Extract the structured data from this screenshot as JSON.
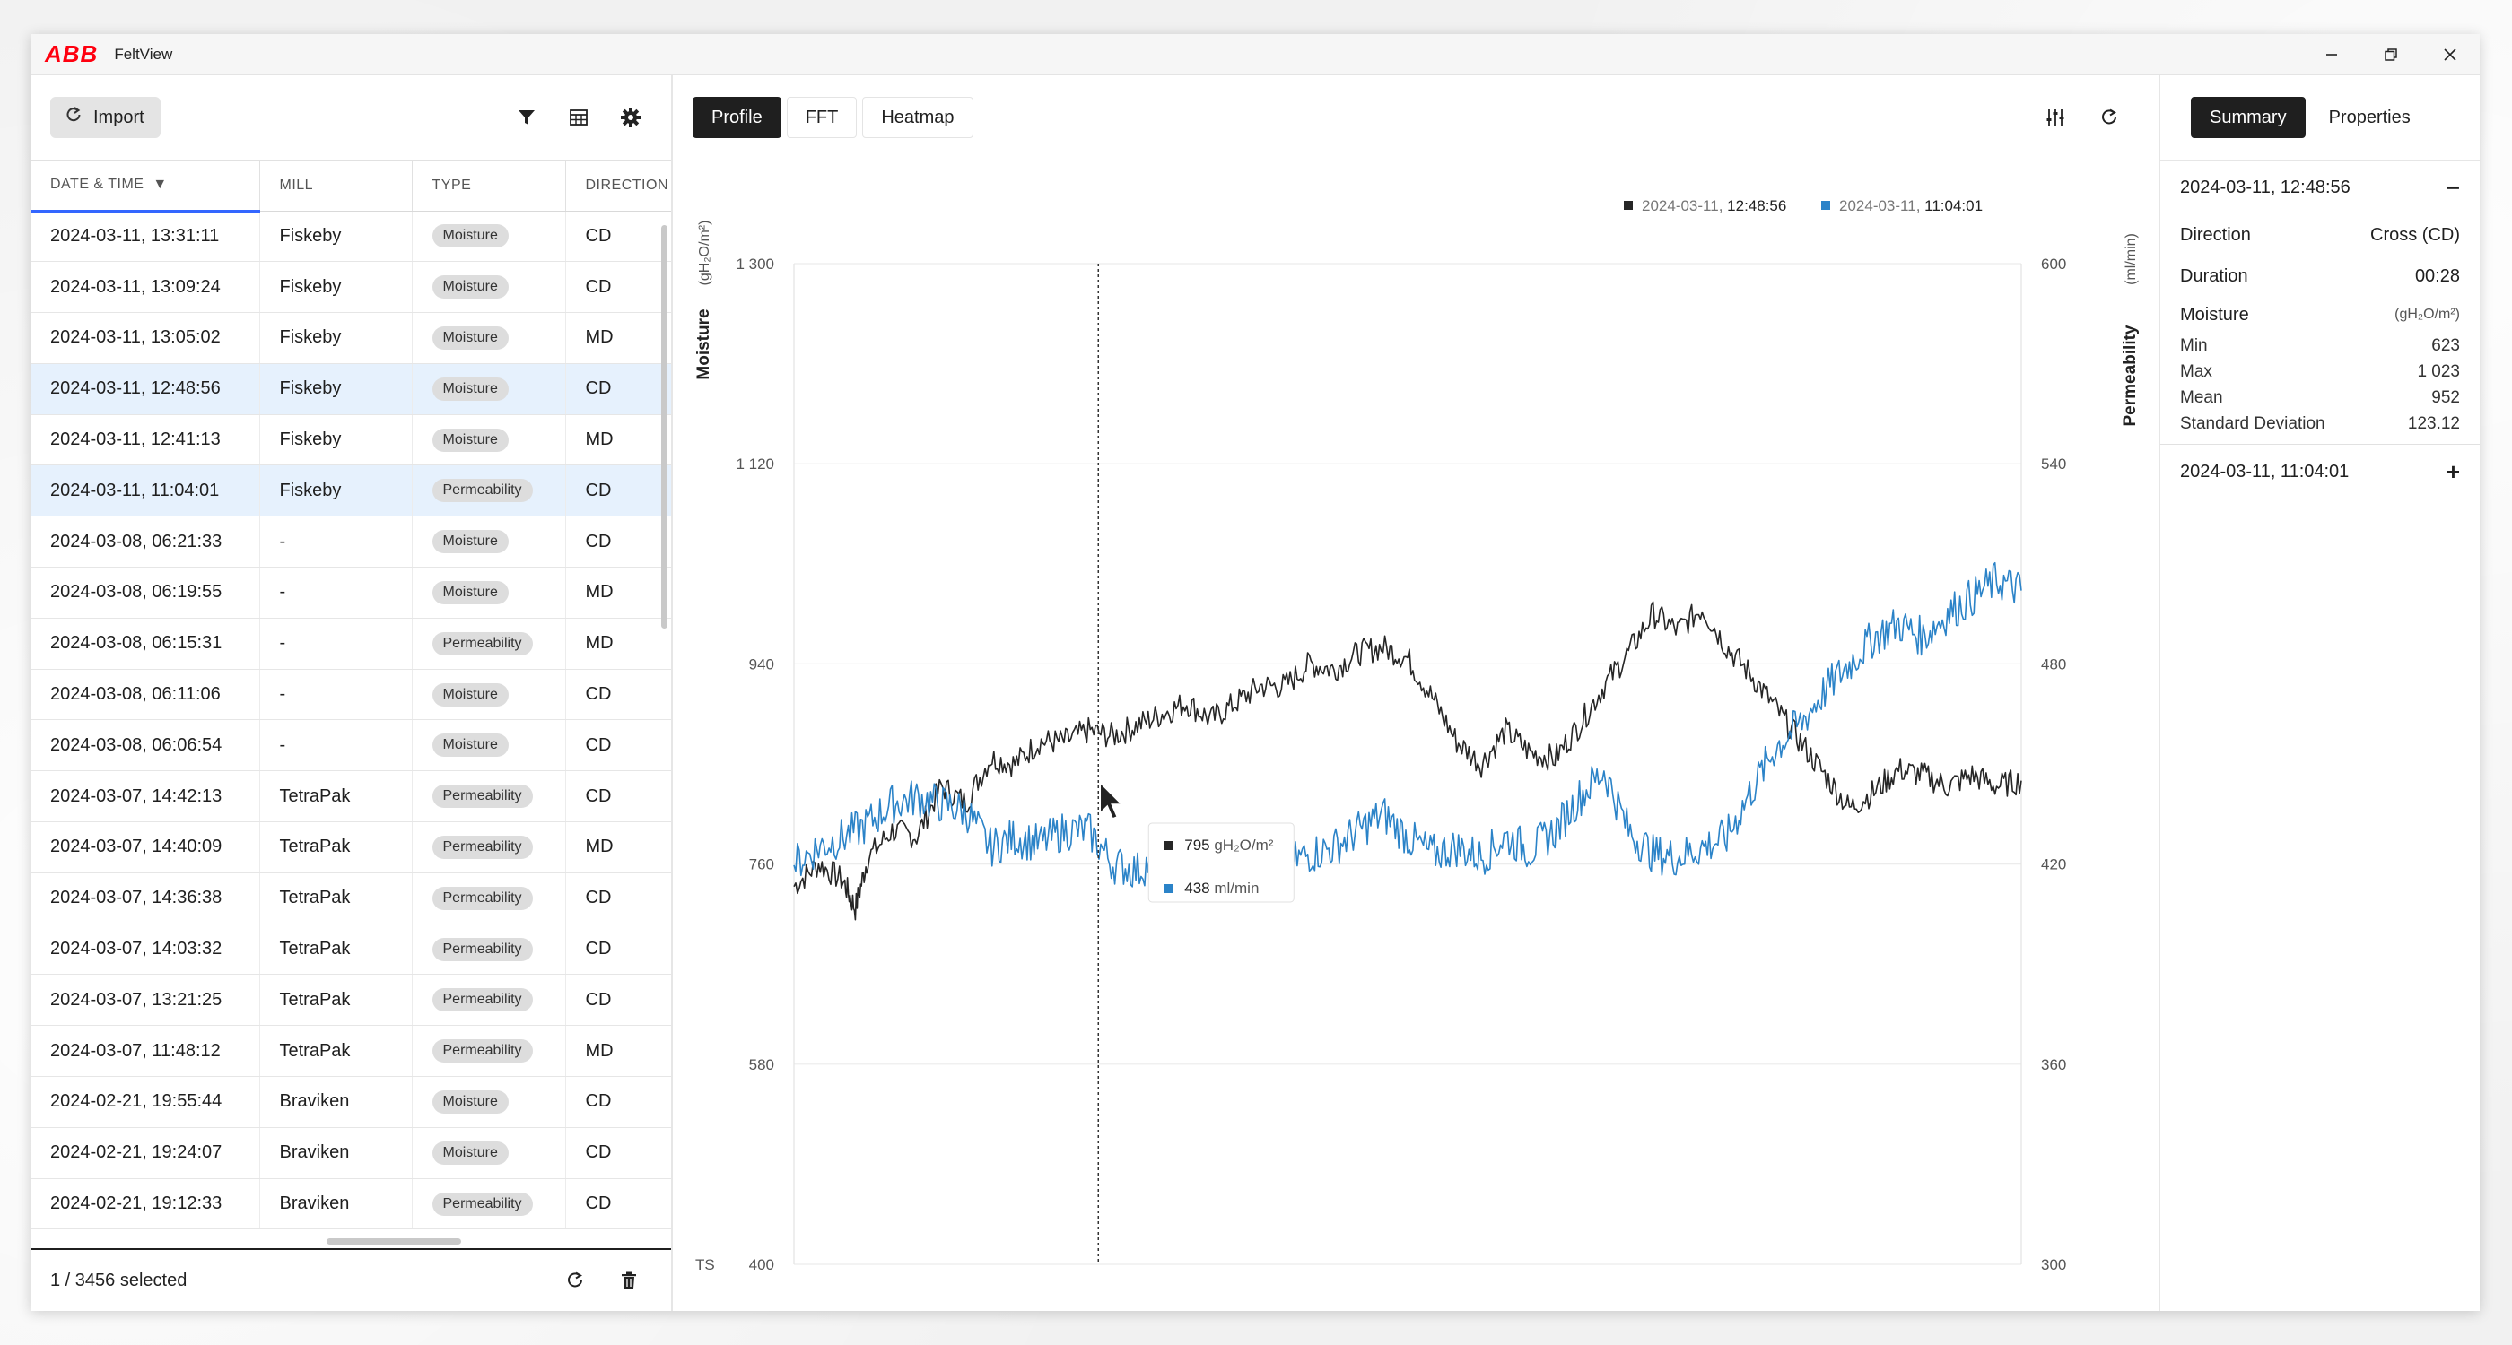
{
  "app": {
    "logo": "ABB",
    "title": "FeltView"
  },
  "left": {
    "import_label": "Import",
    "columns": [
      "DATE & TIME",
      "MILL",
      "TYPE",
      "DIRECTION"
    ],
    "rows": [
      {
        "date": "2024-03-11, 13:31:11",
        "mill": "Fiskeby",
        "type": "Moisture",
        "dir": "CD",
        "selected": false
      },
      {
        "date": "2024-03-11, 13:09:24",
        "mill": "Fiskeby",
        "type": "Moisture",
        "dir": "CD",
        "selected": false
      },
      {
        "date": "2024-03-11, 13:05:02",
        "mill": "Fiskeby",
        "type": "Moisture",
        "dir": "MD",
        "selected": false
      },
      {
        "date": "2024-03-11, 12:48:56",
        "mill": "Fiskeby",
        "type": "Moisture",
        "dir": "CD",
        "selected": true
      },
      {
        "date": "2024-03-11, 12:41:13",
        "mill": "Fiskeby",
        "type": "Moisture",
        "dir": "MD",
        "selected": false
      },
      {
        "date": "2024-03-11, 11:04:01",
        "mill": "Fiskeby",
        "type": "Permeability",
        "dir": "CD",
        "selected": true
      },
      {
        "date": "2024-03-08, 06:21:33",
        "mill": "-",
        "type": "Moisture",
        "dir": "CD",
        "selected": false
      },
      {
        "date": "2024-03-08, 06:19:55",
        "mill": "-",
        "type": "Moisture",
        "dir": "MD",
        "selected": false
      },
      {
        "date": "2024-03-08, 06:15:31",
        "mill": "-",
        "type": "Permeability",
        "dir": "MD",
        "selected": false
      },
      {
        "date": "2024-03-08, 06:11:06",
        "mill": "-",
        "type": "Moisture",
        "dir": "CD",
        "selected": false
      },
      {
        "date": "2024-03-08, 06:06:54",
        "mill": "-",
        "type": "Moisture",
        "dir": "CD",
        "selected": false
      },
      {
        "date": "2024-03-07, 14:42:13",
        "mill": "TetraPak",
        "type": "Permeability",
        "dir": "CD",
        "selected": false
      },
      {
        "date": "2024-03-07, 14:40:09",
        "mill": "TetraPak",
        "type": "Permeability",
        "dir": "MD",
        "selected": false
      },
      {
        "date": "2024-03-07, 14:36:38",
        "mill": "TetraPak",
        "type": "Permeability",
        "dir": "CD",
        "selected": false
      },
      {
        "date": "2024-03-07, 14:03:32",
        "mill": "TetraPak",
        "type": "Permeability",
        "dir": "CD",
        "selected": false
      },
      {
        "date": "2024-03-07, 13:21:25",
        "mill": "TetraPak",
        "type": "Permeability",
        "dir": "CD",
        "selected": false
      },
      {
        "date": "2024-03-07, 11:48:12",
        "mill": "TetraPak",
        "type": "Permeability",
        "dir": "MD",
        "selected": false
      },
      {
        "date": "2024-02-21, 19:55:44",
        "mill": "Braviken",
        "type": "Moisture",
        "dir": "CD",
        "selected": false
      },
      {
        "date": "2024-02-21, 19:24:07",
        "mill": "Braviken",
        "type": "Moisture",
        "dir": "CD",
        "selected": false
      },
      {
        "date": "2024-02-21, 19:12:33",
        "mill": "Braviken",
        "type": "Permeability",
        "dir": "CD",
        "selected": false
      }
    ],
    "footer_count": "1 / 3456 selected"
  },
  "center": {
    "tabs": [
      {
        "label": "Profile",
        "active": true
      },
      {
        "label": "FFT",
        "active": false
      },
      {
        "label": "Heatmap",
        "active": false
      }
    ]
  },
  "chart_data": {
    "type": "line",
    "legend": [
      {
        "date": "2024-03-11,",
        "time": "12:48:56",
        "color": "#262626"
      },
      {
        "date": "2024-03-11,",
        "time": "11:04:01",
        "color": "#2b83c8"
      }
    ],
    "legend_position": "top-right",
    "y_left": {
      "label": "Moisture",
      "unit": "(gH₂O/m²)",
      "ticks": [
        "1 300",
        "1 120",
        "940",
        "760",
        "580",
        "400"
      ],
      "range": [
        400,
        1300
      ]
    },
    "y_right": {
      "label": "Permeability",
      "unit": "(ml/min)",
      "ticks": [
        "600",
        "540",
        "480",
        "420",
        "360",
        "300"
      ],
      "range": [
        300,
        600
      ]
    },
    "x_label": "TS",
    "x_range": [
      0,
      100
    ],
    "grid": true,
    "cursor_x": 24.8,
    "series": [
      {
        "color": "#262626",
        "axis": "left",
        "points": [
          [
            0,
            740
          ],
          [
            2,
            760
          ],
          [
            4,
            745
          ],
          [
            5,
            720
          ],
          [
            6,
            765
          ],
          [
            8,
            790
          ],
          [
            10,
            785
          ],
          [
            12,
            830
          ],
          [
            14,
            815
          ],
          [
            16,
            855
          ],
          [
            18,
            850
          ],
          [
            20,
            870
          ],
          [
            22,
            870
          ],
          [
            24,
            880
          ],
          [
            26,
            875
          ],
          [
            28,
            885
          ],
          [
            30,
            895
          ],
          [
            32,
            905
          ],
          [
            34,
            890
          ],
          [
            36,
            905
          ],
          [
            38,
            920
          ],
          [
            40,
            920
          ],
          [
            42,
            940
          ],
          [
            44,
            935
          ],
          [
            46,
            950
          ],
          [
            48,
            955
          ],
          [
            50,
            945
          ],
          [
            52,
            910
          ],
          [
            54,
            870
          ],
          [
            56,
            850
          ],
          [
            58,
            880
          ],
          [
            60,
            860
          ],
          [
            62,
            855
          ],
          [
            64,
            885
          ],
          [
            66,
            920
          ],
          [
            68,
            950
          ],
          [
            70,
            985
          ],
          [
            72,
            970
          ],
          [
            74,
            990
          ],
          [
            76,
            955
          ],
          [
            78,
            930
          ],
          [
            80,
            900
          ],
          [
            82,
            870
          ],
          [
            84,
            840
          ],
          [
            86,
            810
          ],
          [
            88,
            825
          ],
          [
            90,
            845
          ],
          [
            92,
            840
          ],
          [
            94,
            830
          ],
          [
            96,
            840
          ],
          [
            98,
            830
          ],
          [
            100,
            835
          ]
        ]
      },
      {
        "color": "#2b83c8",
        "axis": "right",
        "points": [
          [
            0,
            420
          ],
          [
            2,
            425
          ],
          [
            4,
            428
          ],
          [
            6,
            432
          ],
          [
            8,
            438
          ],
          [
            10,
            440
          ],
          [
            12,
            438
          ],
          [
            14,
            436
          ],
          [
            16,
            425
          ],
          [
            18,
            428
          ],
          [
            20,
            426
          ],
          [
            22,
            430
          ],
          [
            24,
            430
          ],
          [
            26,
            420
          ],
          [
            28,
            418
          ],
          [
            30,
            423
          ],
          [
            32,
            422
          ],
          [
            34,
            418
          ],
          [
            36,
            425
          ],
          [
            38,
            420
          ],
          [
            40,
            420
          ],
          [
            42,
            423
          ],
          [
            44,
            425
          ],
          [
            46,
            430
          ],
          [
            48,
            435
          ],
          [
            50,
            428
          ],
          [
            52,
            423
          ],
          [
            54,
            425
          ],
          [
            56,
            422
          ],
          [
            58,
            428
          ],
          [
            60,
            424
          ],
          [
            62,
            430
          ],
          [
            64,
            440
          ],
          [
            66,
            448
          ],
          [
            68,
            430
          ],
          [
            70,
            423
          ],
          [
            72,
            422
          ],
          [
            74,
            425
          ],
          [
            76,
            428
          ],
          [
            78,
            442
          ],
          [
            80,
            455
          ],
          [
            82,
            462
          ],
          [
            84,
            472
          ],
          [
            86,
            480
          ],
          [
            88,
            488
          ],
          [
            90,
            492
          ],
          [
            92,
            488
          ],
          [
            94,
            495
          ],
          [
            96,
            500
          ],
          [
            98,
            505
          ],
          [
            100,
            502
          ]
        ]
      }
    ],
    "tooltip": {
      "rows": [
        {
          "value": "795",
          "unit": "gH₂O/m²",
          "color": "#262626"
        },
        {
          "value": "438",
          "unit": "ml/min",
          "color": "#2b83c8"
        }
      ]
    }
  },
  "right": {
    "tabs": [
      {
        "label": "Summary",
        "active": true
      },
      {
        "label": "Properties",
        "active": false
      }
    ],
    "item1": {
      "title": "2024-03-11, 12:48:56",
      "toggle": "−",
      "direction_label": "Direction",
      "direction_value": "Cross (CD)",
      "duration_label": "Duration",
      "duration_value": "00:28",
      "moisture_label": "Moisture",
      "moisture_unit": "(gH₂O/m²)",
      "stats": [
        {
          "label": "Min",
          "value": "623"
        },
        {
          "label": "Max",
          "value": "1 023"
        },
        {
          "label": "Mean",
          "value": "952"
        },
        {
          "label": "Standard Deviation",
          "value": "123.12"
        }
      ]
    },
    "item2": {
      "title": "2024-03-11, 11:04:01",
      "toggle": "+"
    }
  }
}
